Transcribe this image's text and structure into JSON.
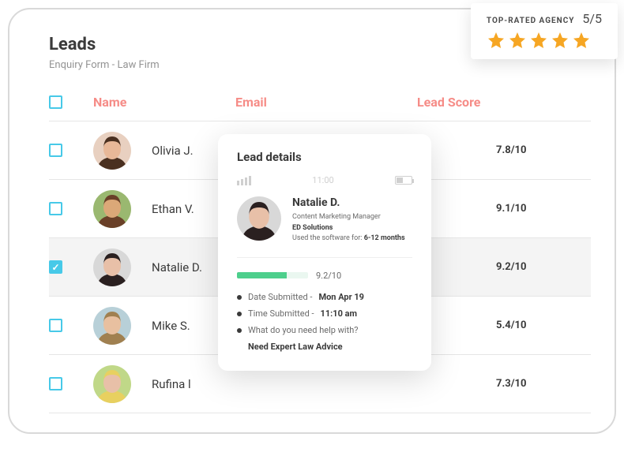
{
  "header": {
    "title": "Leads",
    "subtitle": "Enquiry Form - Law Firm"
  },
  "columns": {
    "name": "Name",
    "email": "Email",
    "score": "Lead Score"
  },
  "rows": [
    {
      "name": "Olivia J.",
      "score": "7.8/10",
      "selected": false,
      "avatar": 0
    },
    {
      "name": "Ethan V.",
      "score": "9.1/10",
      "selected": false,
      "avatar": 1
    },
    {
      "name": "Natalie D.",
      "score": "9.2/10",
      "selected": true,
      "avatar": 2
    },
    {
      "name": "Mike S.",
      "score": "5.4/10",
      "selected": false,
      "avatar": 3
    },
    {
      "name": "Rufina l",
      "score": "7.3/10",
      "selected": false,
      "avatar": 4
    }
  ],
  "rating": {
    "label": "TOP-RATED AGENCY",
    "score": "5/5",
    "stars": 5
  },
  "detail": {
    "title": "Lead details",
    "time": "11:00",
    "name": "Natalie D.",
    "role": "Content Marketing Manager",
    "company": "ED Solutions",
    "usage_label": "Used the software for:",
    "usage_value": "6-12 months",
    "score": "9.2/10",
    "progress_percent": 70,
    "fields": [
      {
        "label": "Date Submitted -",
        "value": "Mon Apr 19"
      },
      {
        "label": "Time Submitted -",
        "value": "11:10 am"
      }
    ],
    "question": "What do you need help with?",
    "answer": "Need Expert Law Advice"
  },
  "avatars": [
    {
      "bg": "#e8d0c0",
      "hair": "#4a3020",
      "skin": "#e8b898"
    },
    {
      "bg": "#9ab870",
      "hair": "#6a4028",
      "skin": "#dba878"
    },
    {
      "bg": "#d8d8d8",
      "hair": "#2a2020",
      "skin": "#e8c0a8"
    },
    {
      "bg": "#b8d0d8",
      "hair": "#a08050",
      "skin": "#e8c0a0"
    },
    {
      "bg": "#c0d888",
      "hair": "#e8d060",
      "skin": "#e8c0a8"
    }
  ]
}
